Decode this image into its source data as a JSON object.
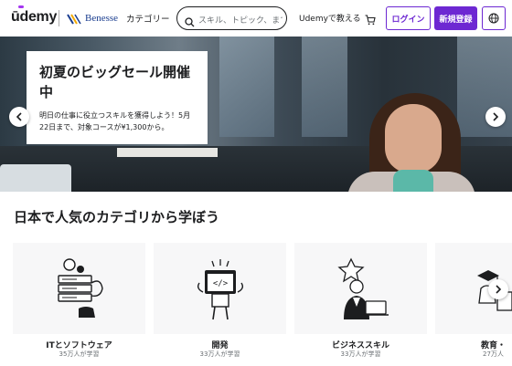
{
  "header": {
    "logo": "ūdemy",
    "partner": "Benesse",
    "categories": "カテゴリー",
    "search_placeholder": "スキル、トピック、まで",
    "teach": "Udemyで教える",
    "login": "ログイン",
    "signup": "新規登録"
  },
  "hero": {
    "title": "初夏のビッグセール開催中",
    "body": "明日の仕事に役立つスキルを獲得しよう！5月22日まで、対象コースが¥1,300から。"
  },
  "section": {
    "title": "日本で人気のカテゴリから学ぼう"
  },
  "categories": [
    {
      "name": "ITとソフトウェア",
      "count": "35万人が学習"
    },
    {
      "name": "開発",
      "count": "33万人が学習"
    },
    {
      "name": "ビジネススキル",
      "count": "33万人が学習"
    },
    {
      "name": "教育・",
      "count": "27万人"
    }
  ],
  "colors": {
    "brand_purple": "#6d28d2",
    "text": "#1c1d1f",
    "muted": "#6a6f73",
    "card_bg": "#f7f7f8"
  }
}
